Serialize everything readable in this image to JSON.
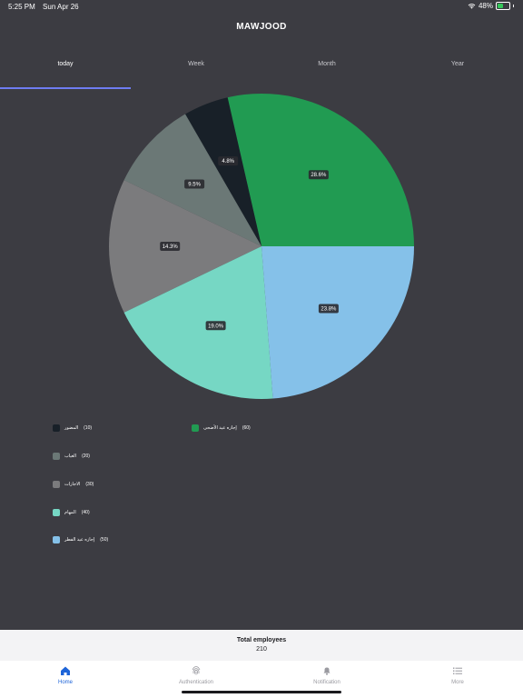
{
  "status": {
    "time": "5:25 PM",
    "date": "Sun Apr 26",
    "battery": "48%",
    "battery_level": 0.48
  },
  "app": {
    "title": "MAWJOOD"
  },
  "tabs": [
    {
      "label": "today",
      "active": true
    },
    {
      "label": "Week",
      "active": false
    },
    {
      "label": "Month",
      "active": false
    },
    {
      "label": "Year",
      "active": false
    }
  ],
  "chart_data": {
    "type": "pie",
    "slices": [
      {
        "label": "إجازه عيد الأضحى",
        "value": 60,
        "percent": "28.6%",
        "color": "#219b52"
      },
      {
        "label": "المضور",
        "value": 10,
        "percent": "4.8%",
        "color": "#182028"
      },
      {
        "label": "الغياب",
        "value": 20,
        "percent": "9.5%",
        "color": "#6b7876"
      },
      {
        "label": "الاجازات",
        "value": 30,
        "percent": "14.3%",
        "color": "#7b7b7d"
      },
      {
        "label": "المهام",
        "value": 40,
        "percent": "19.0%",
        "color": "#76d7c4"
      },
      {
        "label": "إجازه عيد الفطر",
        "value": 50,
        "percent": "23.8%",
        "color": "#85c1e9"
      }
    ]
  },
  "legend": [
    {
      "label": "المضور",
      "value": "(10)",
      "color": "#182028"
    },
    {
      "label": "إجازه عيد الأضحى",
      "value": "(60)",
      "color": "#219b52"
    },
    {
      "label": "الغياب",
      "value": "(20)",
      "color": "#6b7876"
    },
    {
      "label": "الاجازات",
      "value": "(30)",
      "color": "#7b7b7d"
    },
    {
      "label": "المهام",
      "value": "(40)",
      "color": "#76d7c4"
    },
    {
      "label": "إجازه عيد الفطر",
      "value": "(50)",
      "color": "#85c1e9"
    }
  ],
  "total": {
    "title": "Total employees",
    "value": "210"
  },
  "nav": [
    {
      "label": "Home",
      "icon": "home-icon",
      "active": true
    },
    {
      "label": "Authentication",
      "icon": "fingerprint-icon",
      "active": false
    },
    {
      "label": "Notification",
      "icon": "bell-icon",
      "active": false
    },
    {
      "label": "More",
      "icon": "list-icon",
      "active": false
    }
  ]
}
